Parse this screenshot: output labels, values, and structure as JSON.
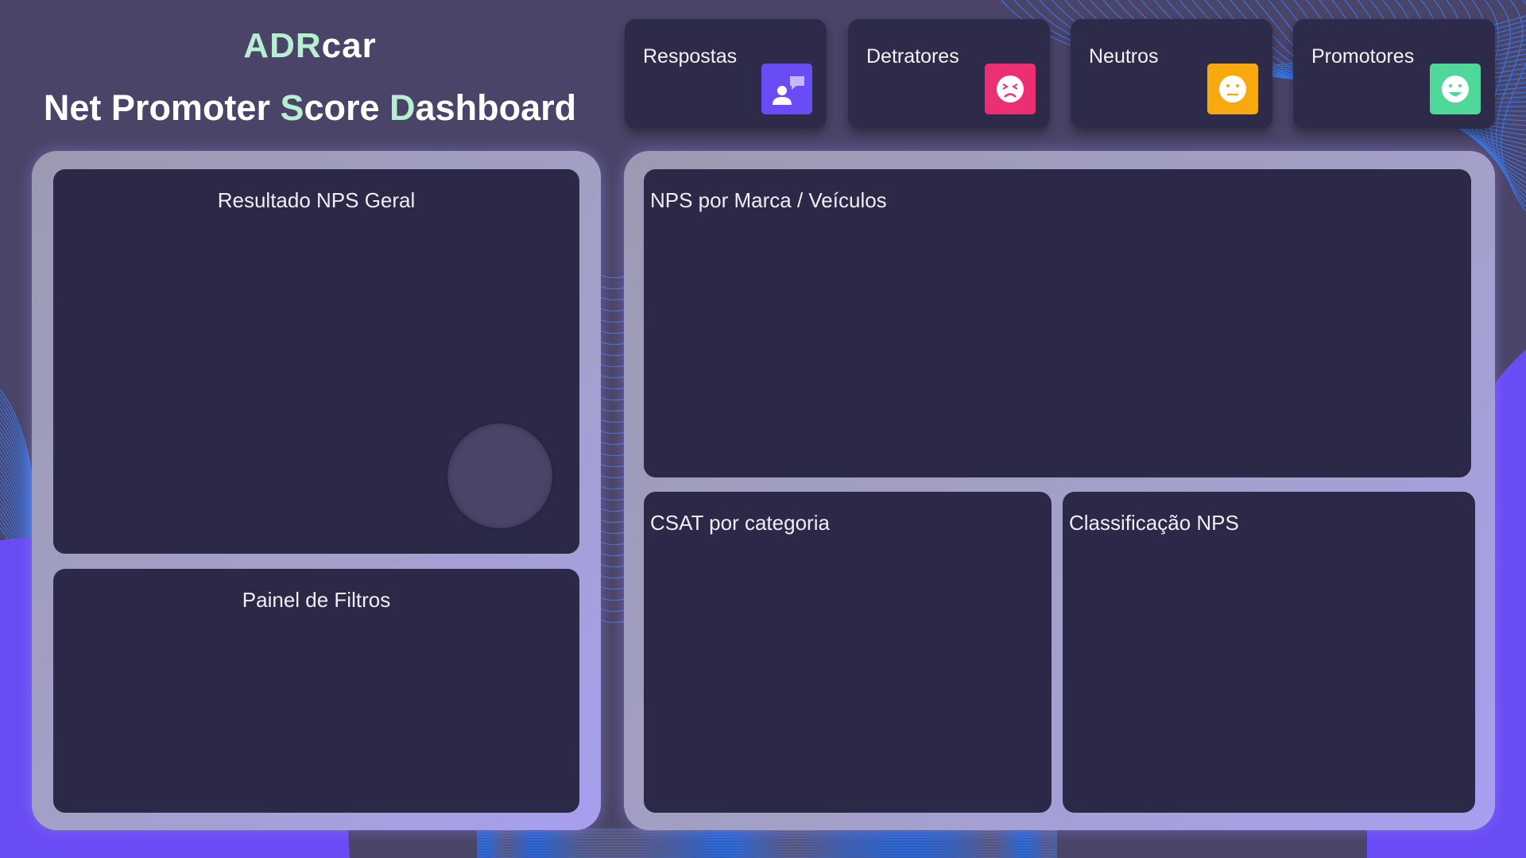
{
  "header": {
    "brand_accent": "ADR",
    "brand_rest": "car",
    "title_parts": [
      "Net Promoter ",
      "S",
      "core ",
      "D",
      "ashboard"
    ]
  },
  "kpis": [
    {
      "label": "Respostas",
      "icon": "user-chat-icon",
      "color": "#6a4cf5"
    },
    {
      "label": "Detratores",
      "icon": "angry-face-icon",
      "color": "#ec2f73"
    },
    {
      "label": "Neutros",
      "icon": "neutral-face-icon",
      "color": "#f7a90f"
    },
    {
      "label": "Promotores",
      "icon": "smile-face-icon",
      "color": "#4fd89a"
    }
  ],
  "panels": {
    "nps_geral": "Resultado NPS Geral",
    "filtros": "Painel de Filtros",
    "marca": "NPS por Marca / Veículos",
    "csat": "CSAT por categoria",
    "classificacao": "Classificação NPS"
  },
  "colors": {
    "background": "#4a4468",
    "panel": "#2c2848",
    "accent_text": "#b7efd2",
    "purple_shape": "#6a4cf5",
    "wave_lines": "#3a7cf0"
  }
}
